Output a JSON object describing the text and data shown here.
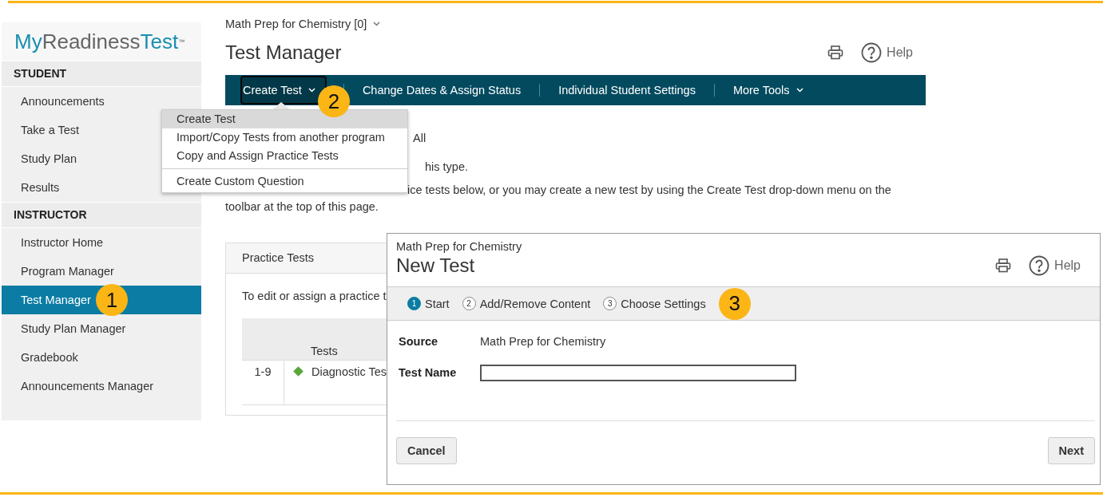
{
  "logo": {
    "parts": [
      "My",
      "Readiness",
      "Test"
    ],
    "trademark": "™"
  },
  "sidebar": {
    "sections": [
      {
        "heading": "STUDENT",
        "items": [
          {
            "label": "Announcements",
            "selected": false
          },
          {
            "label": "Take a Test",
            "selected": false
          },
          {
            "label": "Study Plan",
            "selected": false
          },
          {
            "label": "Results",
            "selected": false
          }
        ]
      },
      {
        "heading": "INSTRUCTOR",
        "items": [
          {
            "label": "Instructor Home",
            "selected": false
          },
          {
            "label": "Program Manager",
            "selected": false
          },
          {
            "label": "Test Manager",
            "selected": true,
            "callout": "1"
          },
          {
            "label": "Study Plan Manager",
            "selected": false
          },
          {
            "label": "Gradebook",
            "selected": false
          },
          {
            "label": "Announcements Manager",
            "selected": false
          }
        ]
      }
    ]
  },
  "main": {
    "course_selector": "Math Prep for Chemistry [0]",
    "title": "Test Manager",
    "help": "Help",
    "toolbar": [
      {
        "label": "Create Test",
        "selected": true,
        "has_menu": true,
        "callout": "2"
      },
      {
        "label": "Change Dates & Assign Status",
        "selected": false,
        "has_menu": false
      },
      {
        "label": "Individual Student Settings",
        "selected": false,
        "has_menu": false
      },
      {
        "label": "More Tools",
        "selected": false,
        "has_menu": true
      }
    ],
    "page_text": [
      "All",
      "his type.",
      "ice tests below, or you may create a new test by using the Create Test drop-down menu on the",
      "toolbar at the top of this page."
    ],
    "practice_tests": {
      "title": "Practice Tests",
      "intro": "To edit or assign a practice t",
      "columns": [
        "Tests"
      ],
      "rows": [
        {
          "range": "1-9",
          "color": "#5aa63c",
          "name": "Diagnostic Tes"
        }
      ]
    }
  },
  "dropdown_menu": {
    "items": [
      {
        "label": "Create Test",
        "selected": true,
        "divider_before": false
      },
      {
        "label": "Import/Copy Tests from another program",
        "selected": false,
        "divider_before": false
      },
      {
        "label": "Copy and Assign Practice Tests",
        "selected": false,
        "divider_before": false
      },
      {
        "label": "Create Custom Question",
        "selected": false,
        "divider_before": true
      }
    ]
  },
  "dialog": {
    "subtitle": "Math Prep for Chemistry",
    "title": "New Test",
    "help": "Help",
    "steps": [
      {
        "number": "1",
        "label": "Start",
        "selected": true
      },
      {
        "number": "2",
        "label": "Add/Remove Content",
        "selected": false
      },
      {
        "number": "3",
        "label": "Choose Settings",
        "selected": false,
        "callout": "3"
      }
    ],
    "fields": [
      {
        "label": "Source",
        "kind": "text",
        "value": "Math Prep for Chemistry"
      },
      {
        "label": "Test Name",
        "kind": "input"
      }
    ],
    "buttons": [
      "Cancel",
      "Next"
    ]
  }
}
